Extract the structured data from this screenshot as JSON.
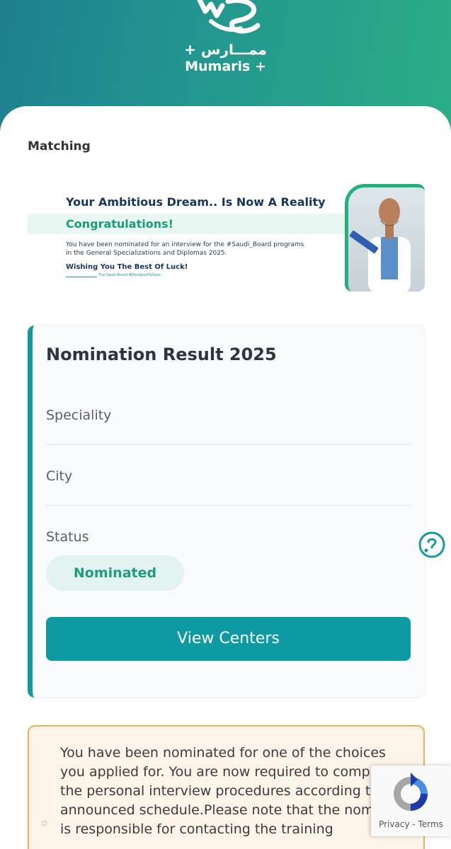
{
  "brand": {
    "name_ar": "+ ممـــارس",
    "name_en": "Mumaris +"
  },
  "section": {
    "title": "Matching"
  },
  "banner": {
    "title": "Your Ambitious Dream.. Is Now A Reality",
    "congrats": "Congratulations!",
    "body": "You have been nominated for an interview for the #Saudi_Board programs in the General Specializations and Diplomas 2025.",
    "wish": "Wishing You The Best Of Luck!",
    "tagline": "The Saudi Board #DesignedToSave"
  },
  "card": {
    "title": "Nomination Result 2025",
    "speciality_label": "Speciality",
    "city_label": "City",
    "status_label": "Status",
    "status_value": "Nominated",
    "view_centers_label": "View Centers"
  },
  "notice": {
    "text": "You have been nominated for one of the choices you applied for. You are now required to complete the personal interview procedures according to the announced schedule.Please note that the nominee is responsible for contacting the training"
  },
  "recaptcha": {
    "privacy": "Privacy",
    "separator": "-",
    "terms": "Terms"
  },
  "icons": {
    "logo": "mumaris-logo-icon",
    "chat": "chat-icon",
    "recaptcha": "recaptcha-icon"
  },
  "colors": {
    "brand_teal": "#13999e",
    "header_start": "#1e7f8f",
    "header_end": "#2aae86",
    "status_green": "#1e9d7b",
    "notice_border": "#e8b457"
  }
}
